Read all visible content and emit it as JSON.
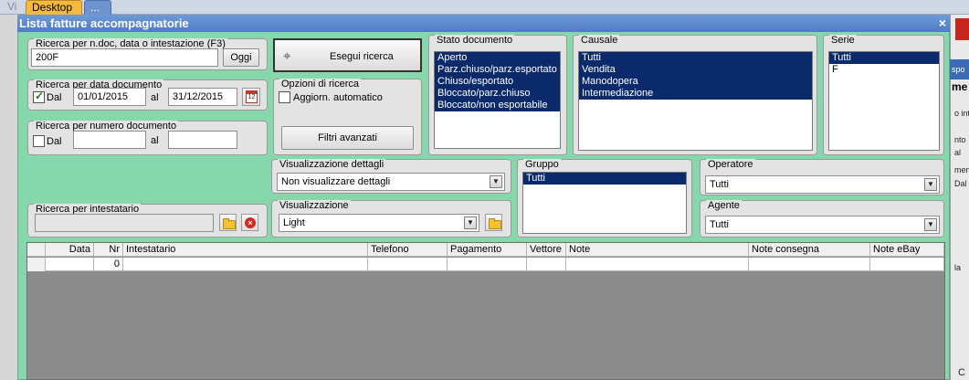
{
  "tabs": {
    "left_partial": "Vi",
    "desktop": "Desktop",
    "more": "..."
  },
  "window": {
    "title": "Lista fatture accompagnatorie",
    "close_glyph": "×"
  },
  "search_doc": {
    "title": "Ricerca per n.doc, data o intestazione (F3)",
    "value": "200F",
    "today_button": "Oggi"
  },
  "search_date": {
    "title": "Ricerca per data documento",
    "checked": true,
    "from_label": "Dal",
    "from_value": "01/01/2015",
    "to_label": "al",
    "to_value": "31/12/2015",
    "calendar_glyph": "12"
  },
  "search_number": {
    "title": "Ricerca per numero documento",
    "checked": false,
    "from_label": "Dal",
    "from_value": "",
    "to_label": "al",
    "to_value": ""
  },
  "search_holder": {
    "title": "Ricerca per intestatario",
    "value": "",
    "delete_glyph": "×"
  },
  "run_search": {
    "label": "Esegui ricerca"
  },
  "search_options": {
    "title": "Opzioni di ricerca",
    "auto_update_label": "Aggiorn. automatico",
    "auto_update_checked": false,
    "advanced_filters": "Filtri avanzati"
  },
  "doc_state": {
    "title": "Stato documento",
    "items": [
      {
        "label": "Aperto",
        "selected": true
      },
      {
        "label": "Parz.chiuso/parz.esportato",
        "selected": true
      },
      {
        "label": "Chiuso/esportato",
        "selected": true
      },
      {
        "label": "Bloccato/parz.chiuso",
        "selected": true
      },
      {
        "label": "Bloccato/non esportabile",
        "selected": true
      }
    ]
  },
  "causale": {
    "title": "Causale",
    "items": [
      {
        "label": "Tutti",
        "selected": true
      },
      {
        "label": "Vendita",
        "selected": true
      },
      {
        "label": "Manodopera",
        "selected": true
      },
      {
        "label": "Intermediazione",
        "selected": true
      }
    ]
  },
  "serie": {
    "title": "Serie",
    "items": [
      {
        "label": "Tutti",
        "selected": true
      },
      {
        "label": "F",
        "selected": false
      }
    ]
  },
  "details_view": {
    "title": "Visualizzazione dettagli",
    "value": "Non visualizzare dettagli"
  },
  "view": {
    "title": "Visualizzazione",
    "value": "Light"
  },
  "group": {
    "title": "Gruppo",
    "items": [
      {
        "label": "Tutti",
        "selected": true
      }
    ]
  },
  "operator": {
    "title": "Operatore",
    "value": "Tutti"
  },
  "agent": {
    "title": "Agente",
    "value": "Tutti"
  },
  "grid": {
    "columns": [
      "",
      "Data",
      "Nr",
      "Intestatario",
      "Telefono",
      "Pagamento",
      "Vettore",
      "Note",
      "Note consegna",
      "Note eBay"
    ],
    "rows": [
      [
        "",
        "",
        "0",
        "",
        "",
        "",
        "",
        "",
        "",
        ""
      ]
    ]
  },
  "right_window": {
    "texts": [
      "spo",
      "me",
      "o inte",
      "nto",
      "al",
      "meni",
      "Dal",
      "la",
      "C"
    ]
  }
}
